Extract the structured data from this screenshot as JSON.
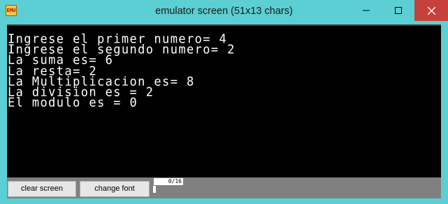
{
  "window": {
    "title": "emulator screen (51x13 chars)",
    "icon_text": "EMU",
    "icon_name": "emulator-app-icon"
  },
  "screen": {
    "lines": [
      "Ingrese el primer numero= 4",
      "Ingrese el segundo numero= 2",
      "La suma es= 6",
      "La resta= 2",
      "La Multiplicacion es= 8",
      "La division es = 2",
      "El modulo es = 0"
    ]
  },
  "toolbar": {
    "clear_label": "clear screen",
    "font_label": "change font",
    "counter": "0/16",
    "progress": 0
  },
  "colors": {
    "window_bg": "#5bcfd3",
    "screen_bg": "#000000",
    "text": "#ffffff",
    "close_button": "#c7413c",
    "toolbar_bg": "#808080"
  }
}
